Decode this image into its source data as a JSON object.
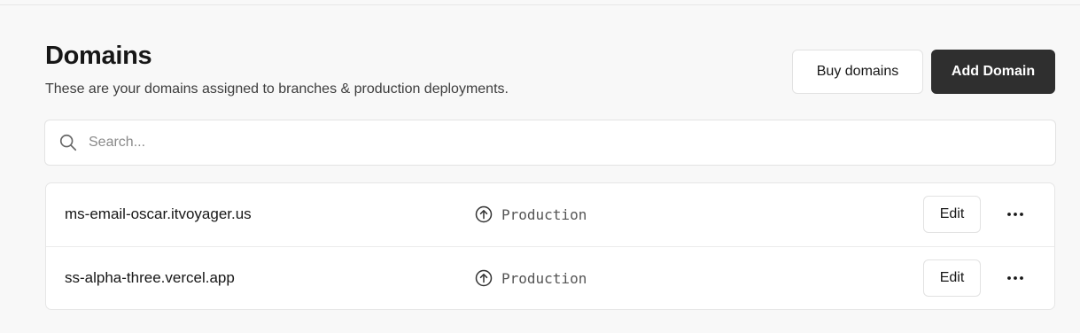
{
  "header": {
    "title": "Domains",
    "subtitle": "These are your domains assigned to branches & production deployments.",
    "buy_domains_label": "Buy domains",
    "add_domain_label": "Add Domain"
  },
  "search": {
    "placeholder": "Search...",
    "value": "",
    "icon": "search-icon"
  },
  "domains": [
    {
      "name": "ms-email-oscar.itvoyager.us",
      "environment": "Production",
      "environment_icon": "arrow-up-circle-icon",
      "edit_label": "Edit",
      "more_icon": "more-horizontal-icon"
    },
    {
      "name": "ss-alpha-three.vercel.app",
      "environment": "Production",
      "environment_icon": "arrow-up-circle-icon",
      "edit_label": "Edit",
      "more_icon": "more-horizontal-icon"
    }
  ],
  "colors": {
    "background": "#f8f8f8",
    "primary_button": "#2f2f2f",
    "text": "#171717",
    "muted_text": "#555555"
  }
}
